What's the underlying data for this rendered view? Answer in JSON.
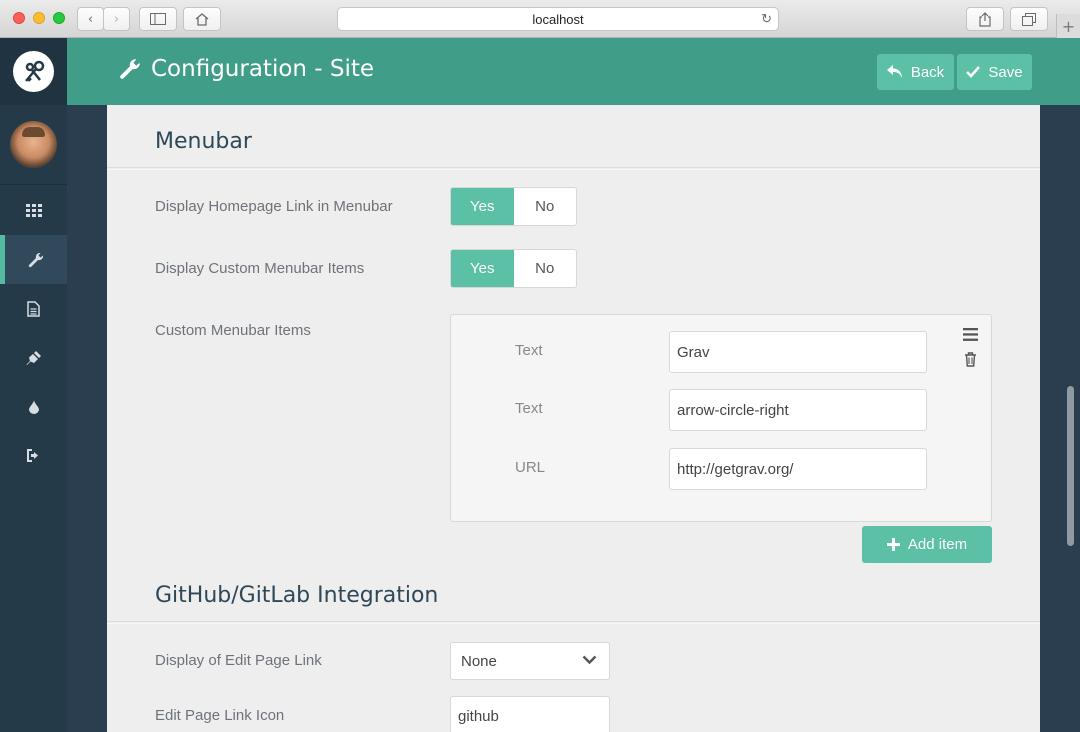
{
  "browser": {
    "url": "localhost"
  },
  "header": {
    "title": "Configuration - Site",
    "back_label": "Back",
    "save_label": "Save"
  },
  "sidebar": {
    "items": [
      {
        "icon": "dashboard-grid-icon"
      },
      {
        "icon": "wrench-icon",
        "active": true
      },
      {
        "icon": "file-icon"
      },
      {
        "icon": "plug-icon"
      },
      {
        "icon": "droplet-icon"
      },
      {
        "icon": "logout-icon"
      }
    ]
  },
  "menubar": {
    "title": "Menubar",
    "display_homepage": {
      "label": "Display Homepage Link in Menubar",
      "yes": "Yes",
      "no": "No",
      "value": "Yes"
    },
    "display_custom": {
      "label": "Display Custom Menubar Items",
      "yes": "Yes",
      "no": "No",
      "value": "Yes"
    },
    "custom_items": {
      "label": "Custom Menubar Items",
      "fields": [
        {
          "label": "Text",
          "value": "Grav"
        },
        {
          "label": "Text",
          "value": "arrow-circle-right"
        },
        {
          "label": "URL",
          "value": "http://getgrav.org/"
        }
      ],
      "add_label": "Add item"
    }
  },
  "github": {
    "title": "GitHub/GitLab Integration",
    "edit_link": {
      "label": "Display of Edit Page Link",
      "value": "None"
    },
    "edit_icon": {
      "label": "Edit Page Link Icon",
      "value": "github"
    }
  },
  "colors": {
    "accent": "#5bc0a5",
    "header": "#3f9d88",
    "sidebar": "#253a48"
  }
}
